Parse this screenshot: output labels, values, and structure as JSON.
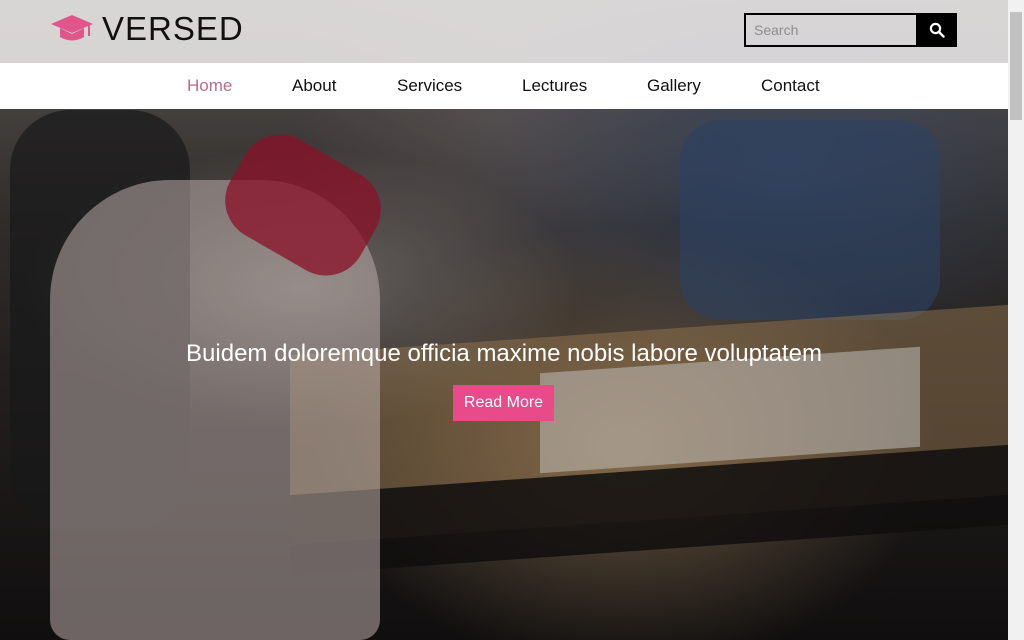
{
  "brand": {
    "name": "VERSED",
    "icon": "graduation-cap-icon",
    "icon_color": "#e0568a"
  },
  "search": {
    "placeholder": "Search",
    "icon": "search-icon"
  },
  "nav": {
    "items": [
      {
        "label": "Home",
        "active": true
      },
      {
        "label": "About"
      },
      {
        "label": "Services"
      },
      {
        "label": "Lectures"
      },
      {
        "label": "Gallery"
      },
      {
        "label": "Contact"
      }
    ],
    "active_color": "#c06a85"
  },
  "hero": {
    "title": "Buidem doloremque officia maxime nobis labore voluptatem",
    "cta_label": "Read More",
    "cta_color": "#e84a8a"
  }
}
